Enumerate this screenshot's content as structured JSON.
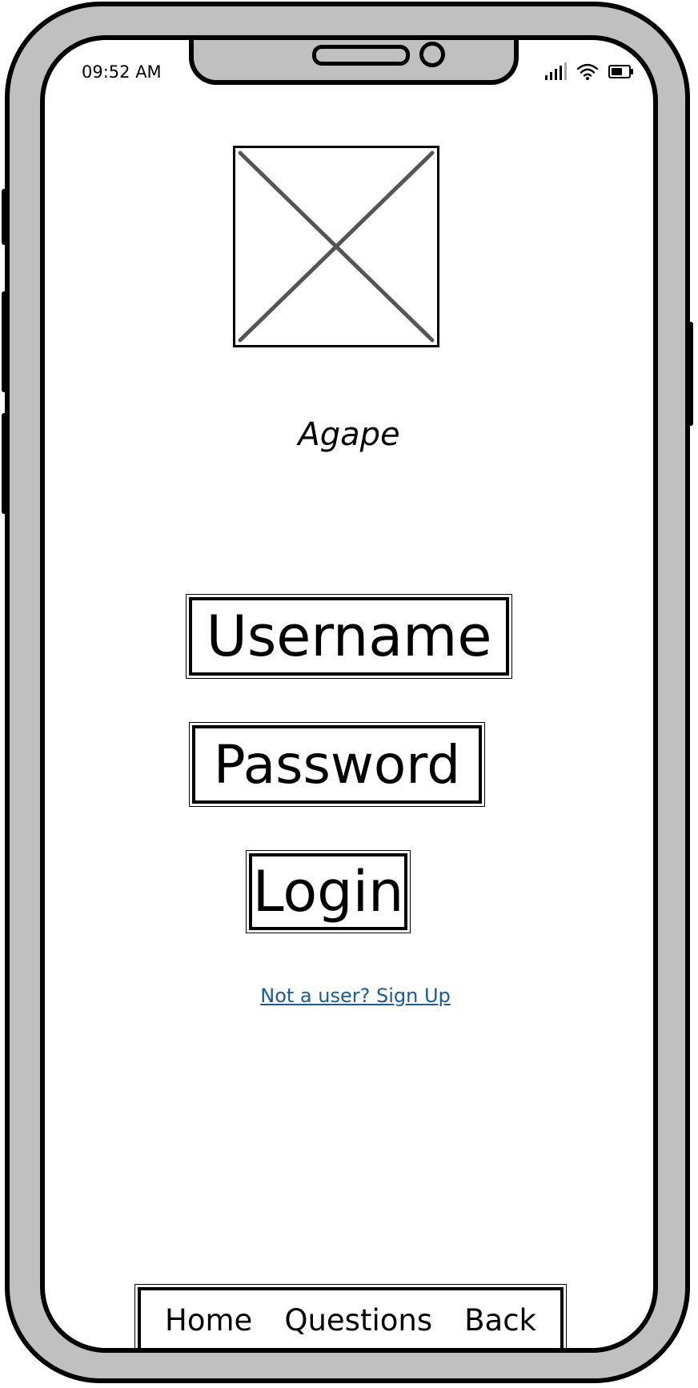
{
  "status_bar": {
    "time": "09:52 AM",
    "signal_bars": 4,
    "battery_level": 0.7
  },
  "header": {
    "app_title": "Agape"
  },
  "login_form": {
    "username_label": "Username",
    "password_label": "Password",
    "login_label": "Login",
    "signup_link": "Not a user? Sign Up"
  },
  "bottom_nav": {
    "items": [
      {
        "label": "Home"
      },
      {
        "label": "Questions"
      },
      {
        "label": "Back"
      }
    ]
  },
  "colors": {
    "frame": "#c0c0c0",
    "outline": "#000000",
    "link": "#1a5a96",
    "placeholder_cross": "#555555"
  },
  "icons": {
    "signal": "signal-icon",
    "wifi": "wifi-icon",
    "battery": "battery-icon",
    "image_placeholder": "image-placeholder-icon"
  }
}
